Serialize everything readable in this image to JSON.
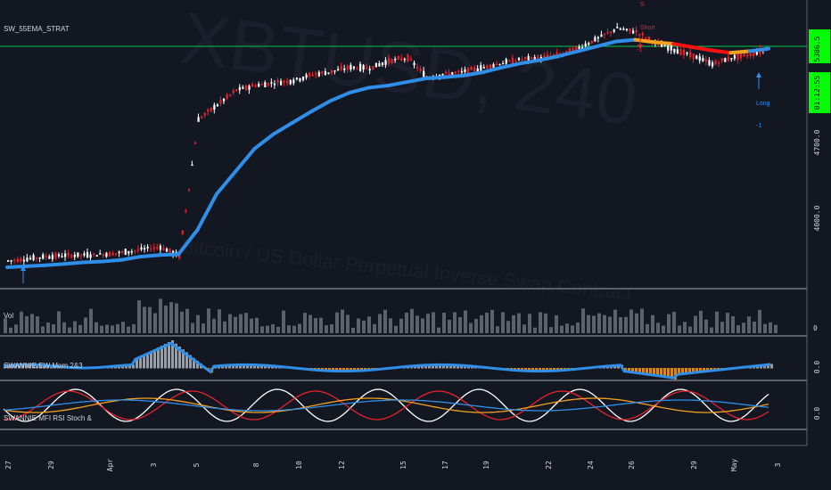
{
  "chart_data": {
    "type": "candlestick",
    "watermark": {
      "symbol": "XBTUSD, 240",
      "description": "Bitcoin / US Dollar Perpetual Inverse Swap Contract"
    },
    "studies": {
      "main": "SW_55EMA_STRAT",
      "volume": "Vol",
      "momentum": "SWANNIE EW Mom 2&3",
      "oscillator": "SWANNIE MFI RSI Stoch &"
    },
    "price_axis": {
      "ticks": [
        "4700.0",
        "4000.0"
      ],
      "last_price": "5386.5",
      "countdown": "01:12:55",
      "accent": "#00ff00"
    },
    "time_axis": [
      "27",
      "29",
      "Apr",
      "3",
      "5",
      "8",
      "10",
      "12",
      "15",
      "17",
      "19",
      "22",
      "24",
      "26",
      "29",
      "May",
      "3"
    ],
    "pane_axis": {
      "volume": "0",
      "momentum": "0.0",
      "oscillator": "0.0"
    },
    "signals": {
      "short": [
        "S",
        "Short",
        "-1"
      ],
      "long": [
        "Long",
        "-1"
      ]
    },
    "price_series": [
      4050,
      4061,
      4075,
      4082,
      4085,
      4090,
      4100,
      4120,
      4135,
      4080,
      4920,
      5010,
      5100,
      5130,
      5145,
      5160,
      5195,
      5215,
      5240,
      5235,
      5280,
      5300,
      5180,
      5200,
      5215,
      5240,
      5270,
      5290,
      5300,
      5320,
      5360,
      5420,
      5480,
      5460,
      5390,
      5350,
      5310,
      5260,
      5300,
      5320,
      5360
    ],
    "ema_series": [
      4010,
      4016,
      4022,
      4030,
      4040,
      4045,
      4055,
      4075,
      4085,
      4090,
      4240,
      4460,
      4600,
      4740,
      4830,
      4900,
      4970,
      5035,
      5085,
      5115,
      5128,
      5150,
      5172,
      5180,
      5190,
      5210,
      5240,
      5265,
      5285,
      5310,
      5340,
      5370,
      5400,
      5410,
      5395,
      5385,
      5365,
      5345,
      5330,
      5340,
      5355
    ],
    "colors": {
      "ema_up": "#2f8fe8",
      "ema_down": "#ff1010",
      "ema_neutral": "#f5a020",
      "candle_up": "#ffffff",
      "candle_down": "#e8212b",
      "volume": "#787b86",
      "level_line": "#00c853"
    },
    "grid": false
  }
}
